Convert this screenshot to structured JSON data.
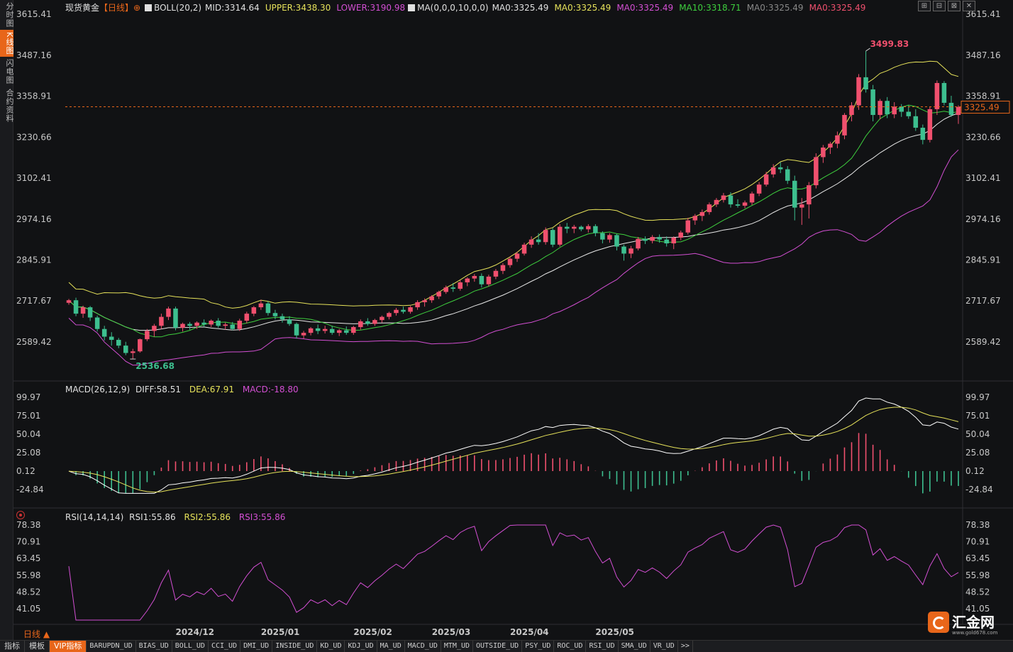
{
  "left_tabs": [
    {
      "label": "分时图",
      "active": false
    },
    {
      "label": "K线图",
      "active": true
    },
    {
      "label": "闪电图",
      "active": false
    },
    {
      "label": "合约资料",
      "active": false
    }
  ],
  "legend": {
    "name": "现货黄金",
    "period": "【日线】",
    "add_icon": "⊕",
    "boll": "BOLL(20,2)",
    "mid": "MID:3314.64",
    "upper": "UPPER:3438.30",
    "lower": "LOWER:3190.98",
    "ma_set": "MA(0,0,0,10,0,0)",
    "ma0_a": "MA0:3325.49",
    "ma0_b": "MA0:3325.49",
    "ma0_c": "MA0:3325.49",
    "ma10": "MA10:3318.71",
    "ma0_d": "MA0:3325.49",
    "ma0_e": "MA0:3325.49"
  },
  "macd_legend": {
    "name": "MACD(26,12,9)",
    "diff": "DIFF:58.51",
    "dea": "DEA:67.91",
    "macd": "MACD:-18.80"
  },
  "rsi_legend": {
    "name": "RSI(14,14,14)",
    "rsi1": "RSI1:55.86",
    "rsi2": "RSI2:55.86",
    "rsi3": "RSI3:55.86"
  },
  "price_axis": [
    "3615.41",
    "3487.16",
    "3358.91",
    "3230.66",
    "3102.41",
    "2974.16",
    "2845.91",
    "2717.67",
    "2589.42"
  ],
  "macd_axis": [
    "99.97",
    "75.01",
    "50.04",
    "25.08",
    "0.12",
    "-24.84"
  ],
  "rsi_axis": [
    "78.38",
    "70.91",
    "63.45",
    "55.98",
    "48.52",
    "41.05"
  ],
  "current_price": "3325.49",
  "high_label": "3499.83",
  "low_label": "2536.68",
  "date_labels": [
    "2024/12",
    "2025/01",
    "2025/02",
    "2025/03",
    "2025/04",
    "2025/05"
  ],
  "period_label": "日线 ▲",
  "window_buttons": [
    "⊞",
    "⊟",
    "⊠",
    "✕"
  ],
  "bottom_tabs": [
    {
      "label": "指标",
      "type": "normal"
    },
    {
      "label": "模板",
      "type": "normal"
    },
    {
      "label": "VIP指标",
      "type": "vip"
    },
    {
      "label": "BARUPDN_UD",
      "type": "mono"
    },
    {
      "label": "BIAS_UD",
      "type": "mono"
    },
    {
      "label": "BOLL_UD",
      "type": "mono"
    },
    {
      "label": "CCI_UD",
      "type": "mono"
    },
    {
      "label": "DMI_UD",
      "type": "mono"
    },
    {
      "label": "INSIDE_UD",
      "type": "mono"
    },
    {
      "label": "KD_UD",
      "type": "mono"
    },
    {
      "label": "KDJ_UD",
      "type": "mono"
    },
    {
      "label": "MA_UD",
      "type": "mono"
    },
    {
      "label": "MACD_UD",
      "type": "mono"
    },
    {
      "label": "MTM_UD",
      "type": "mono"
    },
    {
      "label": "OUTSIDE_UD",
      "type": "mono"
    },
    {
      "label": "PSY_UD",
      "type": "mono"
    },
    {
      "label": "ROC_UD",
      "type": "mono"
    },
    {
      "label": "RSI_UD",
      "type": "mono"
    },
    {
      "label": "SMA_UD",
      "type": "mono"
    },
    {
      "label": "VR_UD",
      "type": "mono"
    },
    {
      "label": ">>",
      "type": "mono"
    }
  ],
  "logo": {
    "text": "汇金网",
    "url": "www.gold678.com"
  },
  "colors": {
    "up": "#f0506e",
    "down": "#3dbf8f",
    "boll": "#e6e25a",
    "mid": "#e8e8e8",
    "lower": "#d34fd3",
    "ma10": "#3ecf3e",
    "diff": "#ffffff",
    "dea": "#e6e25a",
    "rsi": "#d34fd3",
    "accent": "#e8661a"
  },
  "chart_data": {
    "type": "candlestick",
    "candles": [
      [
        2712,
        2724,
        2706,
        2720
      ],
      [
        2720,
        2728,
        2670,
        2678
      ],
      [
        2678,
        2703,
        2665,
        2698
      ],
      [
        2698,
        2702,
        2655,
        2666
      ],
      [
        2666,
        2672,
        2622,
        2630
      ],
      [
        2630,
        2640,
        2594,
        2606
      ],
      [
        2606,
        2620,
        2578,
        2596
      ],
      [
        2596,
        2602,
        2570,
        2578
      ],
      [
        2578,
        2590,
        2548,
        2555
      ],
      [
        2555,
        2568,
        2536,
        2560
      ],
      [
        2560,
        2600,
        2556,
        2598
      ],
      [
        2598,
        2630,
        2592,
        2624
      ],
      [
        2624,
        2646,
        2606,
        2640
      ],
      [
        2640,
        2678,
        2630,
        2668
      ],
      [
        2668,
        2700,
        2658,
        2694
      ],
      [
        2694,
        2700,
        2626,
        2634
      ],
      [
        2634,
        2650,
        2622,
        2646
      ],
      [
        2646,
        2652,
        2628,
        2640
      ],
      [
        2640,
        2654,
        2630,
        2650
      ],
      [
        2650,
        2660,
        2636,
        2644
      ],
      [
        2644,
        2660,
        2636,
        2656
      ],
      [
        2656,
        2664,
        2634,
        2640
      ],
      [
        2640,
        2650,
        2628,
        2644
      ],
      [
        2644,
        2652,
        2626,
        2630
      ],
      [
        2630,
        2662,
        2624,
        2656
      ],
      [
        2656,
        2684,
        2648,
        2678
      ],
      [
        2678,
        2702,
        2670,
        2698
      ],
      [
        2698,
        2722,
        2690,
        2710
      ],
      [
        2710,
        2716,
        2672,
        2680
      ],
      [
        2680,
        2690,
        2660,
        2670
      ],
      [
        2670,
        2678,
        2650,
        2660
      ],
      [
        2660,
        2670,
        2640,
        2646
      ],
      [
        2646,
        2650,
        2600,
        2610
      ],
      [
        2610,
        2624,
        2600,
        2618
      ],
      [
        2618,
        2636,
        2610,
        2632
      ],
      [
        2632,
        2644,
        2614,
        2624
      ],
      [
        2624,
        2640,
        2616,
        2630
      ],
      [
        2630,
        2640,
        2612,
        2618
      ],
      [
        2618,
        2630,
        2608,
        2626
      ],
      [
        2626,
        2638,
        2612,
        2618
      ],
      [
        2618,
        2640,
        2612,
        2636
      ],
      [
        2636,
        2660,
        2628,
        2654
      ],
      [
        2654,
        2664,
        2640,
        2646
      ],
      [
        2646,
        2662,
        2640,
        2658
      ],
      [
        2658,
        2672,
        2650,
        2668
      ],
      [
        2668,
        2684,
        2660,
        2680
      ],
      [
        2680,
        2696,
        2672,
        2690
      ],
      [
        2690,
        2700,
        2678,
        2684
      ],
      [
        2684,
        2702,
        2678,
        2698
      ],
      [
        2698,
        2720,
        2690,
        2714
      ],
      [
        2714,
        2726,
        2700,
        2720
      ],
      [
        2720,
        2736,
        2712,
        2732
      ],
      [
        2732,
        2750,
        2724,
        2746
      ],
      [
        2746,
        2766,
        2740,
        2760
      ],
      [
        2760,
        2774,
        2746,
        2756
      ],
      [
        2756,
        2782,
        2750,
        2776
      ],
      [
        2776,
        2792,
        2764,
        2788
      ],
      [
        2788,
        2802,
        2778,
        2796
      ],
      [
        2796,
        2804,
        2760,
        2770
      ],
      [
        2770,
        2800,
        2764,
        2794
      ],
      [
        2794,
        2818,
        2786,
        2812
      ],
      [
        2812,
        2836,
        2802,
        2830
      ],
      [
        2830,
        2856,
        2822,
        2850
      ],
      [
        2850,
        2872,
        2840,
        2866
      ],
      [
        2866,
        2900,
        2860,
        2894
      ],
      [
        2894,
        2920,
        2884,
        2910
      ],
      [
        2910,
        2930,
        2894,
        2902
      ],
      [
        2902,
        2948,
        2894,
        2940
      ],
      [
        2940,
        2946,
        2886,
        2894
      ],
      [
        2894,
        2958,
        2888,
        2950
      ],
      [
        2950,
        2962,
        2930,
        2944
      ],
      [
        2944,
        2956,
        2930,
        2950
      ],
      [
        2950,
        2954,
        2936,
        2942
      ],
      [
        2942,
        2958,
        2932,
        2952
      ],
      [
        2952,
        2958,
        2920,
        2930
      ],
      [
        2930,
        2936,
        2898,
        2910
      ],
      [
        2910,
        2930,
        2900,
        2924
      ],
      [
        2924,
        2928,
        2876,
        2888
      ],
      [
        2888,
        2894,
        2844,
        2866
      ],
      [
        2866,
        2890,
        2852,
        2882
      ],
      [
        2882,
        2918,
        2876,
        2912
      ],
      [
        2912,
        2920,
        2896,
        2906
      ],
      [
        2906,
        2924,
        2898,
        2918
      ],
      [
        2918,
        2926,
        2900,
        2910
      ],
      [
        2910,
        2920,
        2888,
        2898
      ],
      [
        2898,
        2920,
        2880,
        2916
      ],
      [
        2916,
        2938,
        2908,
        2932
      ],
      [
        2932,
        2978,
        2926,
        2970
      ],
      [
        2970,
        2990,
        2956,
        2984
      ],
      [
        2984,
        3004,
        2968,
        2996
      ],
      [
        2996,
        3026,
        2988,
        3020
      ],
      [
        3020,
        3040,
        3012,
        3034
      ],
      [
        3034,
        3056,
        3026,
        3048
      ],
      [
        3048,
        3058,
        3010,
        3020
      ],
      [
        3020,
        3036,
        3010,
        3016
      ],
      [
        3016,
        3032,
        3008,
        3026
      ],
      [
        3026,
        3060,
        3018,
        3054
      ],
      [
        3054,
        3090,
        3046,
        3082
      ],
      [
        3082,
        3122,
        3076,
        3114
      ],
      [
        3114,
        3146,
        3104,
        3136
      ],
      [
        3136,
        3152,
        3118,
        3130
      ],
      [
        3130,
        3140,
        3084,
        3094
      ],
      [
        3094,
        3110,
        2970,
        3010
      ],
      [
        3010,
        3040,
        2956,
        3020
      ],
      [
        3020,
        3090,
        2976,
        3080
      ],
      [
        3080,
        3180,
        3070,
        3168
      ],
      [
        3168,
        3206,
        3150,
        3198
      ],
      [
        3198,
        3216,
        3178,
        3210
      ],
      [
        3210,
        3248,
        3196,
        3236
      ],
      [
        3236,
        3306,
        3224,
        3300
      ],
      [
        3300,
        3340,
        3280,
        3330
      ],
      [
        3330,
        3428,
        3316,
        3418
      ],
      [
        3418,
        3500,
        3370,
        3380
      ],
      [
        3380,
        3394,
        3280,
        3300
      ],
      [
        3300,
        3350,
        3286,
        3344
      ],
      [
        3344,
        3356,
        3290,
        3302
      ],
      [
        3302,
        3340,
        3290,
        3326
      ],
      [
        3326,
        3334,
        3294,
        3310
      ],
      [
        3310,
        3330,
        3288,
        3296
      ],
      [
        3296,
        3318,
        3250,
        3260
      ],
      [
        3260,
        3270,
        3208,
        3222
      ],
      [
        3222,
        3326,
        3214,
        3318
      ],
      [
        3318,
        3408,
        3300,
        3400
      ],
      [
        3400,
        3406,
        3330,
        3338
      ],
      [
        3338,
        3360,
        3294,
        3300
      ],
      [
        3300,
        3330,
        3272,
        3325
      ]
    ],
    "macd_axis_range": [
      -24.84,
      99.97
    ],
    "rsi_axis_range": [
      41.05,
      78.38
    ],
    "price_axis_range": [
      2589.42,
      3615.41
    ]
  }
}
